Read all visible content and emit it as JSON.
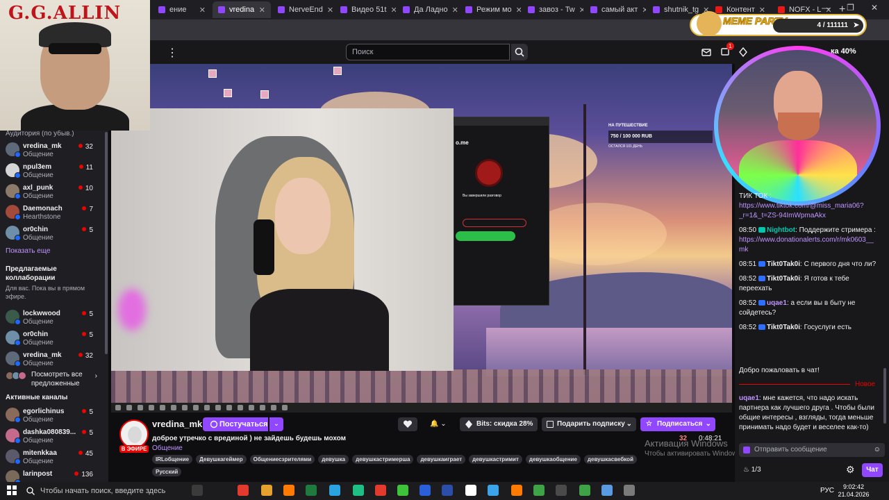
{
  "browser": {
    "tabs": [
      {
        "label": "ение",
        "icon": "twitch-icon",
        "active": false
      },
      {
        "label": "vredina",
        "icon": "twitch-icon",
        "active": true
      },
      {
        "label": "NerveEnd",
        "icon": "twitch-icon",
        "active": false
      },
      {
        "label": "Видео 51t",
        "icon": "twitch-icon",
        "active": false
      },
      {
        "label": "Да Ладно",
        "icon": "twitch-icon",
        "active": false
      },
      {
        "label": "Режим мо",
        "icon": "twitch-icon",
        "active": false
      },
      {
        "label": "завоз - Tw",
        "icon": "twitch-icon",
        "active": false
      },
      {
        "label": "самый акт",
        "icon": "twitch-icon",
        "active": false
      },
      {
        "label": "shutnik_tg",
        "icon": "twitch-icon",
        "active": false
      },
      {
        "label": "Контент",
        "icon": "youtube-icon",
        "active": false
      },
      {
        "label": "NOFX - L",
        "icon": "youtube-icon",
        "active": false
      }
    ]
  },
  "topnav": {
    "search_placeholder": "Поиск",
    "notif_count": "1",
    "bits_discount": "ка 40%"
  },
  "overlay_left": {
    "title": "G.G.ALLIN"
  },
  "sidebar": {
    "header_partial": "Аудитория (по убыв.)",
    "followed": [
      {
        "name": "vredina_mk",
        "category": "Общение",
        "viewers": "32",
        "color": "#5e6a7a"
      },
      {
        "name": "npul3em",
        "category": "Общение",
        "viewers": "11",
        "color": "#d5d5d5"
      },
      {
        "name": "axl_punk",
        "category": "Общение",
        "viewers": "10",
        "color": "#8c7a6a"
      },
      {
        "name": "Daemonach",
        "category": "Hearthstone",
        "viewers": "7",
        "color": "#a44a3a"
      },
      {
        "name": "or0chin",
        "category": "Общение",
        "viewers": "5",
        "color": "#6f8fa8"
      }
    ],
    "show_more": "Показать еще",
    "collab_title": "Предлагаемые коллаборации",
    "collab_sub": "Для вас. Пока вы в прямом эфире.",
    "collabs": [
      {
        "name": "lockwwood",
        "category": "Общение",
        "viewers": "5",
        "color": "#3a5a4a"
      },
      {
        "name": "or0chin",
        "category": "Общение",
        "viewers": "5",
        "color": "#6f8fa8"
      },
      {
        "name": "vredina_mk",
        "category": "Общение",
        "viewers": "32",
        "color": "#5e6a7a"
      }
    ],
    "see_all": "Посмотреть все предложенные",
    "active_title": "Активные каналы",
    "active": [
      {
        "name": "egorlichinus",
        "category": "Общение",
        "viewers": "5",
        "color": "#8a6a5a"
      },
      {
        "name": "dashka080839...",
        "category": "Общение",
        "viewers": "5",
        "color": "#c46a8a"
      },
      {
        "name": "mitenkkaa",
        "category": "Общение",
        "viewers": "45",
        "color": "#5a5a6a"
      },
      {
        "name": "larinpost",
        "category": "",
        "viewers": "136",
        "color": "#7a6a5a"
      }
    ]
  },
  "player": {
    "goal_label": "НА ПУТЕШЕСТВИЕ",
    "goal_amount": "750 / 100 000 RUB",
    "goal_days": "ОСТАЛСЯ 101 ДЕНЬ",
    "site_label": "o.me",
    "finished_text": "Вы завершили разговор"
  },
  "stream": {
    "streamer": "vredina_mk",
    "live_badge": "В ЭФИРЕ",
    "raid_label": "Постучаться",
    "title": "доброе утречко с врединой ) не зайдешь будешь мохом",
    "category": "Общение",
    "tags": [
      "IRLобщение",
      "Девушкагеймер",
      "Общениесзрителями",
      "девушка",
      "девушкастримерша",
      "девушкаиграет",
      "девушкастримит",
      "девушкаобщение",
      "девушкасвебкой",
      "Русский"
    ],
    "bits_label": "Bits: скидка 28%",
    "gift_label": "Подарить подписку",
    "subscribe_label": "Подписаться",
    "viewers": "32",
    "uptime": "0:48:21",
    "windows_activation_title": "Активация Windows",
    "windows_activation_sub": "Чтобы активировать Windows, перейдите в раздел \"Параметры\"."
  },
  "meme_party": {
    "label": "MEME PARTY",
    "counter": "4 / 111111"
  },
  "chat": {
    "messages": [
      {
        "time": "",
        "user": "",
        "color": "#efeff1",
        "text": "ТИК ТОК :",
        "link": "https://www.tiktok.com/@miss_maria06?_r=1&_t=ZS-94ImWpmaAkx"
      },
      {
        "time": "08:50",
        "user": "Nightbot",
        "color": "#00c8af",
        "text": ": Поддержите стримера :",
        "link": "https://www.donationalerts.com/r/mk0603__mk"
      },
      {
        "time": "08:51",
        "user": "Tikt0Tak0i",
        "color": "#efeff1",
        "text": ": С первого дня что ли?",
        "link": ""
      },
      {
        "time": "08:52",
        "user": "Tikt0Tak0i",
        "color": "#efeff1",
        "text": ": Я готов к тебе переехать",
        "link": ""
      },
      {
        "time": "08:52",
        "user": "uqae1",
        "color": "#bf94ff",
        "text": ": а если вы в быту не сойдетесь?",
        "link": ""
      },
      {
        "time": "08:52",
        "user": "Tikt0Tak0i",
        "color": "#efeff1",
        "text": ": Госуслуги есть",
        "link": ""
      }
    ],
    "welcome": "Добро пожаловать в чат!",
    "new_label": "Новое",
    "last_message": {
      "user": "uqae1",
      "color": "#bf94ff",
      "text": ": мне кажется, что надо искать партнера как лучшего друга . Чтобы были общие интересы , взгляды, тогда меньше принимать надо будет и веселее как-то)"
    },
    "input_placeholder": "Отправить сообщение",
    "points": "1/3",
    "chat_button": "Чат"
  },
  "taskbar": {
    "search_placeholder": "Чтобы начать поиск, введите здесь запрос",
    "lang": "РУС",
    "time": "9:02:42",
    "date": "21.04.2026"
  }
}
